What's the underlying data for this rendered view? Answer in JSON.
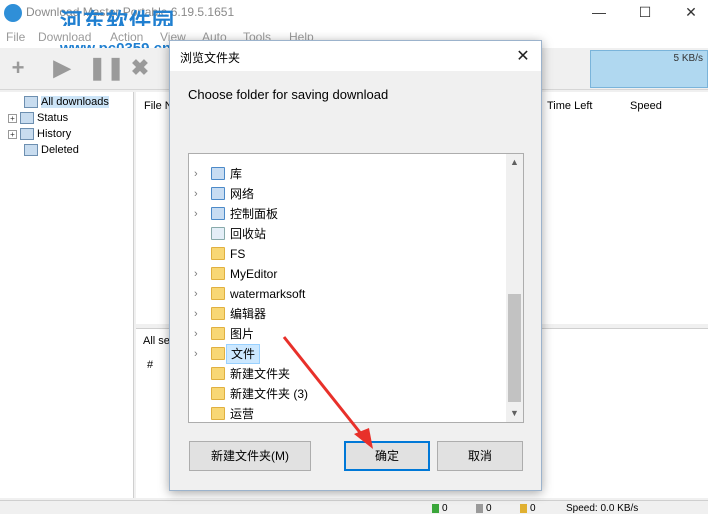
{
  "app": {
    "title": "Download Master Portable 6.19.5.1651",
    "watermark": "河东软件园",
    "watermark_url": "www.pc0359.cn",
    "window_buttons": {
      "minimize": "—",
      "maximize": "☐",
      "close": "✕"
    }
  },
  "menu": [
    "File",
    "Download",
    "Action",
    "View",
    "Auto",
    "Tools",
    "Help"
  ],
  "toolbar": {
    "speed": "5 KB/s"
  },
  "tree": [
    {
      "label": "All downloads",
      "icon": "downloads-icon",
      "selected": true,
      "expandable": false
    },
    {
      "label": "Status",
      "icon": "status-icon",
      "selected": false,
      "expandable": true
    },
    {
      "label": "History",
      "icon": "history-icon",
      "selected": false,
      "expandable": true
    },
    {
      "label": "Deleted",
      "icon": "trash-icon",
      "selected": false,
      "expandable": false
    }
  ],
  "list_headers": {
    "file_name": "File N",
    "time_left": "Time Left",
    "speed": "Speed"
  },
  "lower_panel": {
    "tab": "All se",
    "hash_col": "#"
  },
  "statusbar": {
    "count1": "0",
    "count2": "0",
    "count3": "0",
    "speed": "Speed: 0.0 KB/s"
  },
  "dialog": {
    "title": "浏览文件夹",
    "close": "✕",
    "instruction": "Choose folder for saving download",
    "folders": [
      {
        "label": "库",
        "type": "sys",
        "expandable": true
      },
      {
        "label": "网络",
        "type": "sys",
        "expandable": true
      },
      {
        "label": "控制面板",
        "type": "sys",
        "expandable": true
      },
      {
        "label": "回收站",
        "type": "bin",
        "expandable": false
      },
      {
        "label": "FS",
        "type": "folder",
        "expandable": false
      },
      {
        "label": "MyEditor",
        "type": "folder",
        "expandable": true
      },
      {
        "label": "watermarksoft",
        "type": "folder",
        "expandable": true
      },
      {
        "label": "编辑器",
        "type": "folder",
        "expandable": true
      },
      {
        "label": "图片",
        "type": "folder",
        "expandable": true
      },
      {
        "label": "文件",
        "type": "folder",
        "expandable": true,
        "selected": true
      },
      {
        "label": "新建文件夹",
        "type": "folder",
        "expandable": false
      },
      {
        "label": "新建文件夹 (3)",
        "type": "folder",
        "expandable": false
      },
      {
        "label": "运营",
        "type": "folder",
        "expandable": false
      }
    ],
    "buttons": {
      "new_folder": "新建文件夹(M)",
      "ok": "确定",
      "cancel": "取消"
    }
  },
  "colors": {
    "accent": "#0078d7",
    "selection": "#cce8ff",
    "annotation": "#e8302a"
  }
}
